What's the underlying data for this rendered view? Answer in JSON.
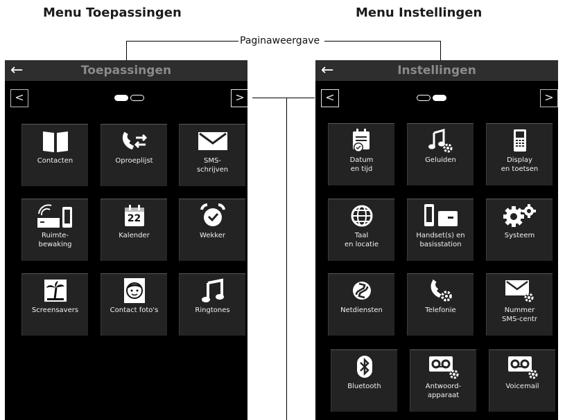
{
  "headings": {
    "left": "Menu Toepassingen",
    "right": "Menu Instellingen"
  },
  "annotation": {
    "label": "Paginaweergave"
  },
  "left_phone": {
    "title": "Toepassingen",
    "back_glyph": "←",
    "prev_glyph": "<",
    "next_glyph": ">",
    "tiles": [
      {
        "label": "Contacten",
        "icon": "book-icon"
      },
      {
        "label": "Oproeplijst",
        "icon": "call-list-icon"
      },
      {
        "label": "SMS-\nschrijven",
        "icon": "envelope-icon"
      },
      {
        "label": "Ruimte-\nbewaking",
        "icon": "room-monitor-icon"
      },
      {
        "label": "Kalender",
        "icon": "calendar-icon",
        "calendar_day": "22"
      },
      {
        "label": "Wekker",
        "icon": "alarm-clock-icon"
      },
      {
        "label": "Screensavers",
        "icon": "palm-tree-icon"
      },
      {
        "label": "Contact foto's",
        "icon": "face-portrait-icon"
      },
      {
        "label": "Ringtones",
        "icon": "music-note-icon"
      }
    ]
  },
  "right_phone": {
    "title": "Instellingen",
    "back_glyph": "←",
    "prev_glyph": "<",
    "next_glyph": ">",
    "tiles": [
      {
        "label": "Datum\nen tijd",
        "icon": "date-time-icon"
      },
      {
        "label": "Geluiden",
        "icon": "sound-settings-icon"
      },
      {
        "label": "Display\nen toetsen",
        "icon": "display-keys-icon"
      },
      {
        "label": "Taal\nen locatie",
        "icon": "globe-icon"
      },
      {
        "label": "Handset(s) en\nbasisstation",
        "icon": "handset-base-icon"
      },
      {
        "label": "Systeem",
        "icon": "gears-icon"
      },
      {
        "label": "Netdiensten",
        "icon": "network-services-icon"
      },
      {
        "label": "Telefonie",
        "icon": "telephony-icon"
      },
      {
        "label": "Nummer\nSMS-centr",
        "icon": "sms-center-icon"
      },
      {
        "label": "Bluetooth",
        "icon": "bluetooth-icon"
      },
      {
        "label": "Antwoord-\napparaat",
        "icon": "answering-machine-icon"
      },
      {
        "label": "Voicemail",
        "icon": "voicemail-icon"
      }
    ]
  }
}
